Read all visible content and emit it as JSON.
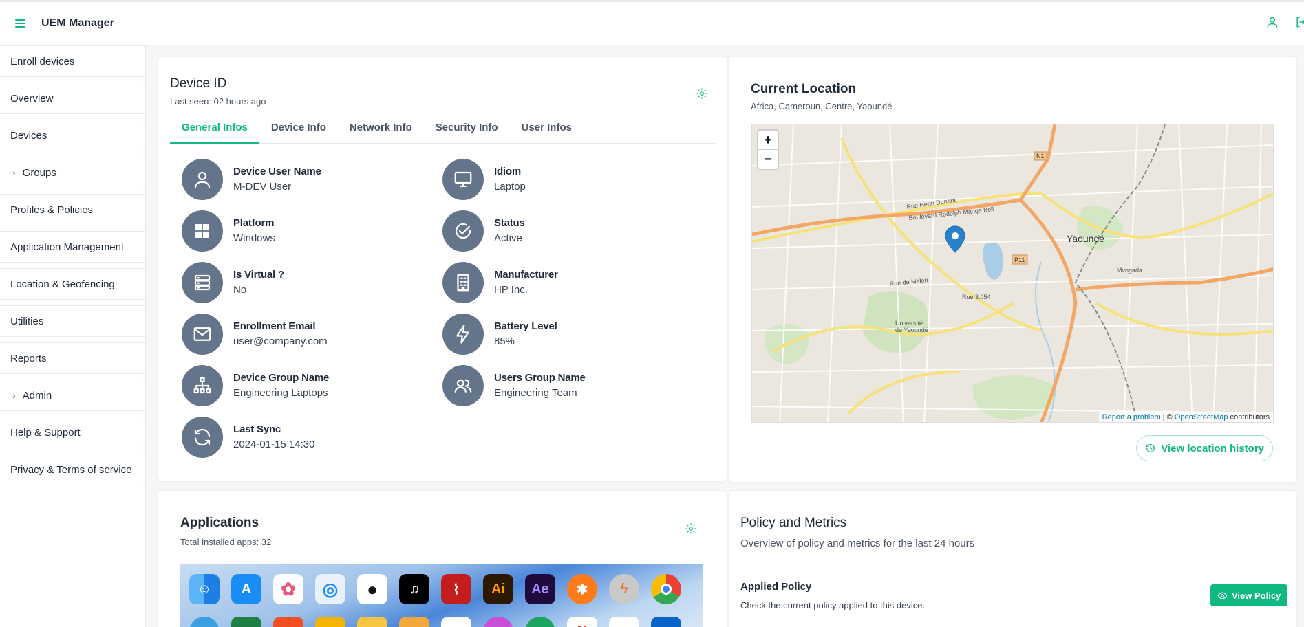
{
  "header": {
    "app_title": "UEM Manager"
  },
  "sidebar": {
    "items": [
      {
        "label": "Enroll devices"
      },
      {
        "label": "Overview"
      },
      {
        "label": "Devices"
      },
      {
        "label": "Groups"
      },
      {
        "label": "Profiles & Policies"
      },
      {
        "label": "Application Management"
      },
      {
        "label": "Location & Geofencing"
      },
      {
        "label": "Utilities"
      },
      {
        "label": "Reports"
      },
      {
        "label": "Admin"
      },
      {
        "label": "Help & Support"
      },
      {
        "label": "Privacy & Terms of service"
      }
    ]
  },
  "device": {
    "title": "Device ID",
    "last_seen": "Last seen: 02 hours ago",
    "tabs": [
      "General Infos",
      "Device Info",
      "Network Info",
      "Security Info",
      "User Infos"
    ],
    "active_tab": "General Infos",
    "fields": [
      {
        "label": "Device User Name",
        "value": "M-DEV User",
        "icon": "user-icon"
      },
      {
        "label": "Idiom",
        "value": "Laptop",
        "icon": "monitor-icon"
      },
      {
        "label": "Platform",
        "value": "Windows",
        "icon": "windows-icon"
      },
      {
        "label": "Status",
        "value": "Active",
        "icon": "check-circle-icon"
      },
      {
        "label": "Is Virtual ?",
        "value": "No",
        "icon": "server-icon"
      },
      {
        "label": "Manufacturer",
        "value": "HP Inc.",
        "icon": "building-icon"
      },
      {
        "label": "Enrollment Email",
        "value": "user@company.com",
        "icon": "mail-icon"
      },
      {
        "label": "Battery Level",
        "value": "85%",
        "icon": "bolt-icon"
      },
      {
        "label": "Device Group Name",
        "value": "Engineering Laptops",
        "icon": "network-icon"
      },
      {
        "label": "Users Group Name",
        "value": "Engineering Team",
        "icon": "users-icon"
      },
      {
        "label": "Last Sync",
        "value": "2024-01-15 14:30",
        "icon": "refresh-icon"
      }
    ]
  },
  "location": {
    "title": "Current Location",
    "address": "Africa, Cameroun, Centre, Yaoundé",
    "map": {
      "city_label": "Yaoundé",
      "zoom_in": "+",
      "zoom_out": "−",
      "labels": [
        "Rue Henri Dunant",
        "Boulevard Rodolph Manga Bell",
        "Mvogada",
        "Université de Yaoundé",
        "Rue de Melen",
        "Rue 3.054",
        "P11",
        "N1"
      ],
      "attribution_problem": "Report a problem",
      "attribution_sep": " | © ",
      "attribution_osm": "OpenStreetMap",
      "attribution_tail": " contributors"
    },
    "history_button": "View location history"
  },
  "applications": {
    "title": "Applications",
    "subtitle": "Total installed apps: 32"
  },
  "policy": {
    "title": "Policy and Metrics",
    "subtitle": "Overview of policy and metrics for the last 24 hours",
    "applied_title": "Applied Policy",
    "applied_desc": "Check the current policy applied to this device.",
    "view_button": "View Policy"
  },
  "colors": {
    "accent": "#10b981",
    "icon_circle": "#64748b"
  }
}
